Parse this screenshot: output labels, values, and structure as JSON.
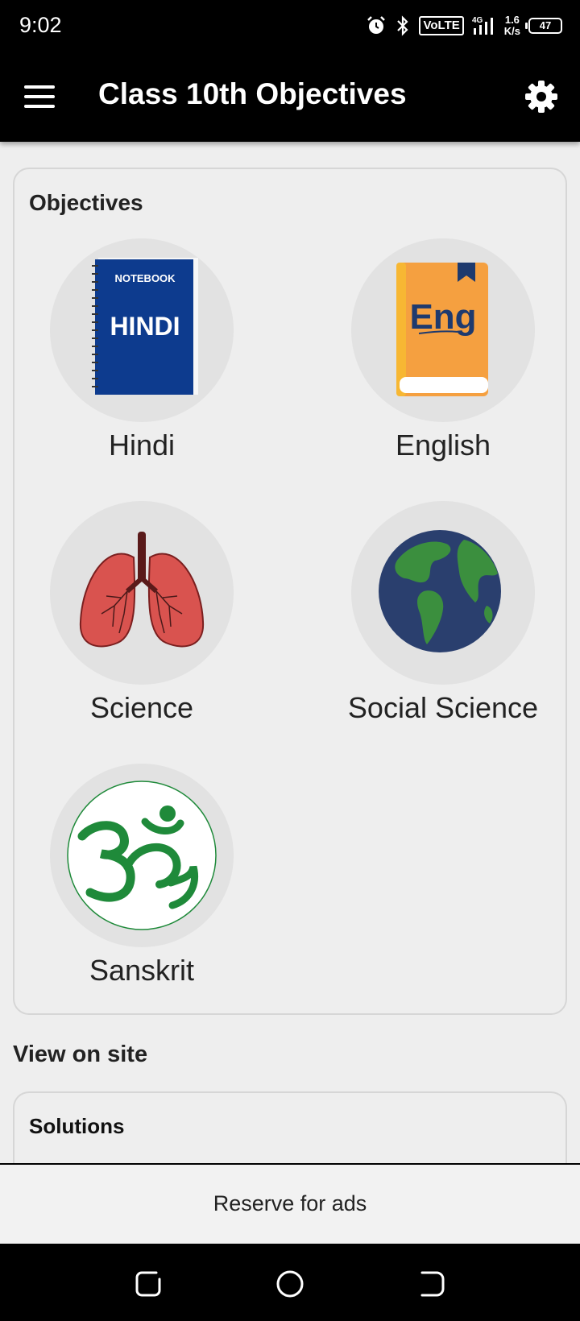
{
  "status_bar": {
    "time": "9:02",
    "network_gen": "4G",
    "volte": "VoLTE",
    "speed_value": "1.6",
    "speed_unit": "K/s",
    "battery": "47"
  },
  "app_bar": {
    "title": "Class 10th Objectives",
    "menu_icon": "hamburger-menu-icon",
    "settings_icon": "gear-icon"
  },
  "objectives": {
    "title": "Objectives",
    "subjects": [
      {
        "label": "Hindi",
        "icon": "hindi-notebook-icon",
        "icon_text_top": "NOTEBOOK",
        "icon_text_main": "HINDI"
      },
      {
        "label": "English",
        "icon": "english-book-icon",
        "icon_text_main": "Eng"
      },
      {
        "label": "Science",
        "icon": "lungs-icon"
      },
      {
        "label": "Social Science",
        "icon": "globe-icon"
      },
      {
        "label": "Sanskrit",
        "icon": "om-icon"
      }
    ]
  },
  "view_on_site": {
    "title": "View on site",
    "items": [
      {
        "label": "Solutions"
      }
    ]
  },
  "ads": {
    "label": "Reserve for ads"
  },
  "colors": {
    "app_bar": "#000000",
    "background": "#eeeeee",
    "icon_circle": "#e2e2e2",
    "hindi_blue": "#0d3b8e",
    "english_orange": "#f5a040",
    "lung_red": "#d9534f",
    "globe_blue": "#2a3f6e",
    "globe_green": "#3b8f3e",
    "om_green": "#1f8a3a"
  }
}
